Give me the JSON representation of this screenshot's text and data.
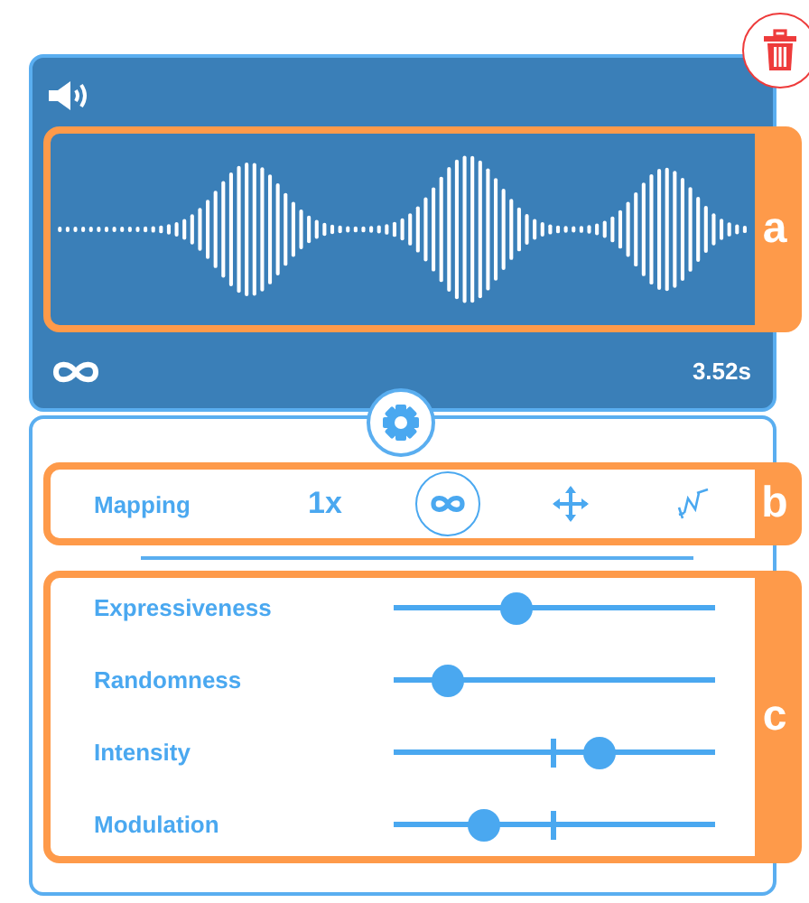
{
  "sound": {
    "duration": "3.52s",
    "loop": true
  },
  "callouts": [
    {
      "label": "a"
    },
    {
      "label": "b"
    },
    {
      "label": "c"
    }
  ],
  "mapping": {
    "label": "Mapping",
    "options": [
      {
        "kind": "text",
        "text": "1x",
        "selected": false
      },
      {
        "kind": "infinity",
        "selected": true
      },
      {
        "kind": "move",
        "selected": false
      },
      {
        "kind": "squiggle",
        "selected": false
      }
    ]
  },
  "sliders": [
    {
      "label": "Expressiveness",
      "level": 0.38,
      "center_tick": false
    },
    {
      "label": "Randomness",
      "level": 0.17,
      "center_tick": false
    },
    {
      "label": "Intensity",
      "level": 0.64,
      "center_tick": true
    },
    {
      "label": "Modulation",
      "level": 0.28,
      "center_tick": true
    }
  ]
}
